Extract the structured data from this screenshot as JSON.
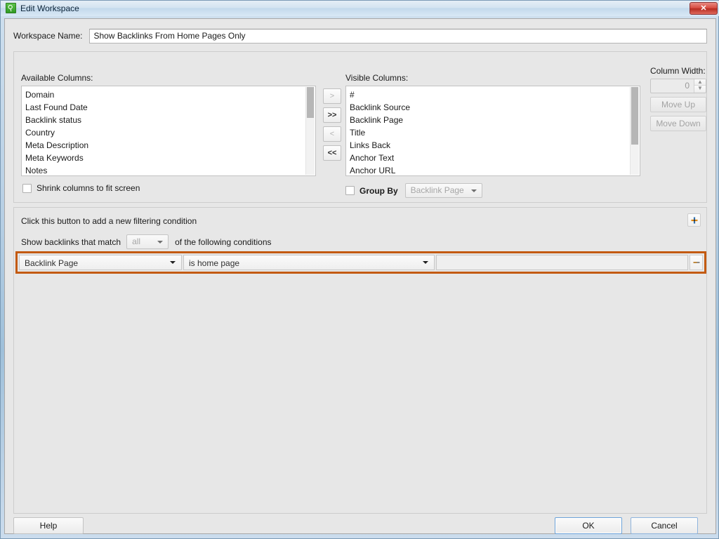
{
  "window": {
    "title": "Edit Workspace",
    "icon": "magnifier-icon",
    "close_label": "✕",
    "accent_selected": "#c35a11",
    "titlebar_color": "#c3d9ec"
  },
  "workspace": {
    "label": "Workspace Name:",
    "value": "Show Backlinks From Home Pages Only",
    "placeholder": "Workspace name"
  },
  "columns": {
    "available_caption": "Available Columns:",
    "visible_caption": "Visible Columns:",
    "available_items": [
      "Domain",
      "Last Found Date",
      "Backlink status",
      "Country",
      "Meta Description",
      "Meta Keywords",
      "Notes"
    ],
    "visible_items": [
      "#",
      "Backlink Source",
      "Backlink Page",
      "Title",
      "Links Back",
      "Anchor Text",
      "Anchor URL"
    ],
    "transfer_buttons": [
      {
        "label": ">",
        "name": "move-right-one-button",
        "enabled": false
      },
      {
        "label": ">>",
        "name": "move-right-all-button",
        "enabled": true
      },
      {
        "label": "<",
        "name": "move-left-one-button",
        "enabled": false
      },
      {
        "label": "<<",
        "name": "move-left-all-button",
        "enabled": true
      }
    ],
    "column_width_label": "Column Width:",
    "column_width_value": "0",
    "move_up_label": "Move Up",
    "move_down_label": "Move Down",
    "shrink_label": "Shrink columns to fit screen",
    "shrink_checked": false,
    "group_by_label": "Group By",
    "group_by_checked": false,
    "group_by_value": "Backlink Page"
  },
  "filter": {
    "hint": "Click this button to add a new filtering condition",
    "add_button_label": "+",
    "match_prefix": "Show backlinks that match",
    "match_value": "all",
    "match_suffix": "of the following conditions",
    "conditions": [
      {
        "field": "Backlink Page",
        "operator": "is home page",
        "value": "",
        "remove_label": "-"
      }
    ]
  },
  "footer": {
    "help_label": "Help",
    "ok_label": "OK",
    "cancel_label": "Cancel"
  }
}
